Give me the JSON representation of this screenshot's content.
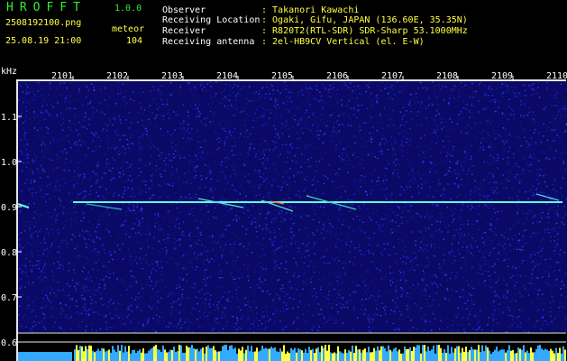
{
  "app": {
    "name": "HROFFT",
    "version": "1.0.0"
  },
  "file": {
    "name": "2508192100.png",
    "datetime": "25.08.19 21:00"
  },
  "counter": {
    "label": "meteor",
    "value": "104"
  },
  "info": [
    {
      "label": "Observer",
      "value": ": Takanori Kawachi"
    },
    {
      "label": "Receiving Location",
      "value": ": Ogaki, Gifu, JAPAN (136.60E, 35.35N)"
    },
    {
      "label": "Receiver",
      "value": ": R820T2(RTL-SDR) SDR-Sharp 53.1000MHz"
    },
    {
      "label": "Receiving antenna",
      "value": ": 2el-HB9CV Vertical (el. E-W)"
    }
  ],
  "axis": {
    "unit": "kHz",
    "time_ticks": [
      "2101",
      "2102",
      "2103",
      "2104",
      "2105",
      "2106",
      "2107",
      "2108",
      "2109",
      "2110"
    ],
    "freq_ticks": [
      "1.1",
      "1.0",
      "0.9",
      "0.8",
      "0.7",
      "0.6"
    ]
  },
  "colors": {
    "background": "#000000",
    "noise": "#1a1acc",
    "signal": "#66ffdd",
    "title": "#33ee33",
    "text": "#ffffff",
    "value": "#ffff44"
  }
}
